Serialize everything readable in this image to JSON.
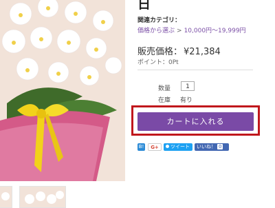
{
  "product": {
    "title_fragment": "日"
  },
  "category": {
    "label": "関連カテゴリ：",
    "crumbs": [
      "価格から選ぶ",
      "10,000円～19,999円"
    ],
    "separator": ">"
  },
  "price": {
    "label": "販売価格：",
    "value": "¥21,384"
  },
  "points": {
    "label": "ポイント：",
    "value": "0Pt"
  },
  "quantity": {
    "label": "数量",
    "value": "1"
  },
  "stock": {
    "label": "在庫",
    "value": "有り"
  },
  "cart_button": {
    "label": "カートに入れる"
  },
  "share": {
    "hatena": "B!",
    "gplus": "G+",
    "tweet": "ツイート",
    "like": "いいね！",
    "like_count": "0"
  },
  "colors": {
    "accent_purple": "#7a4aa6",
    "highlight_red": "#c0171c",
    "link_purple": "#7b4fa6"
  }
}
